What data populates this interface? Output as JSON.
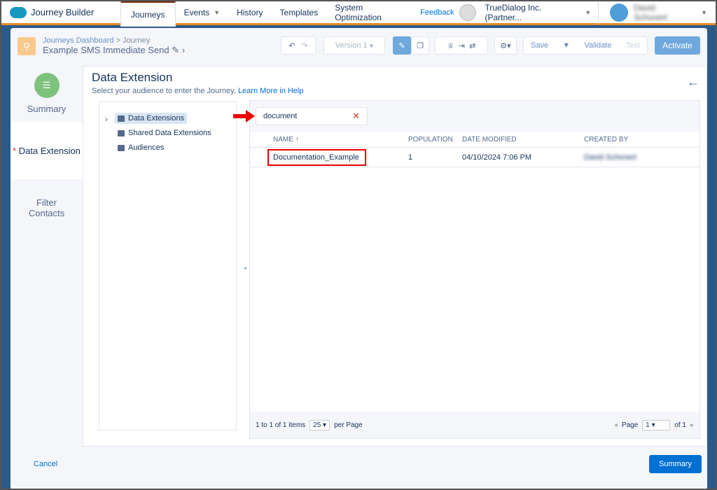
{
  "nav": {
    "app": "Journey Builder",
    "tabs": [
      {
        "label": "Journeys"
      },
      {
        "label": "Events"
      },
      {
        "label": "History"
      },
      {
        "label": "Templates"
      },
      {
        "label": "System Optimization"
      }
    ],
    "feedback": "Feedback",
    "org": "TrueDialog Inc. (Partner...",
    "user": "David Schonert"
  },
  "header": {
    "breadcrumb_link": "Journeys Dashboard",
    "breadcrumb_current": "Journey",
    "journey_name": "Example SMS Immediate Send",
    "version": "Version 1",
    "save": "Save",
    "validate": "Validate",
    "test": "Test",
    "activate": "Activate"
  },
  "steps": [
    {
      "label": "Summary"
    },
    {
      "label": "Data Extension",
      "required": "*"
    },
    {
      "label": "Filter Contacts"
    }
  ],
  "panel": {
    "title": "Data Extension",
    "subtitle": "Select your audience to enter the Journey.",
    "help_link": "Learn More in Help"
  },
  "tree": [
    {
      "label": "Data Extensions"
    },
    {
      "label": "Shared Data Extensions"
    },
    {
      "label": "Audiences"
    }
  ],
  "search": {
    "value": "document"
  },
  "table": {
    "columns": [
      "NAME",
      "POPULATION",
      "DATE MODIFIED",
      "CREATED BY"
    ],
    "rows": [
      {
        "name": "Documentation_Example",
        "population": "1",
        "modified": "04/10/2024 7:06 PM",
        "created_by": "David Schonert"
      }
    ]
  },
  "pager": {
    "summary": "1 to 1 of 1 items",
    "per_page": "25",
    "per_page_label": "per Page",
    "page_label": "Page",
    "page": "1",
    "of": "of 1"
  },
  "footer": {
    "cancel": "Cancel",
    "summary": "Summary"
  },
  "colors": {
    "accent": "#0070d2",
    "nav_underline": "#e8892b",
    "highlight": "#e00000"
  }
}
